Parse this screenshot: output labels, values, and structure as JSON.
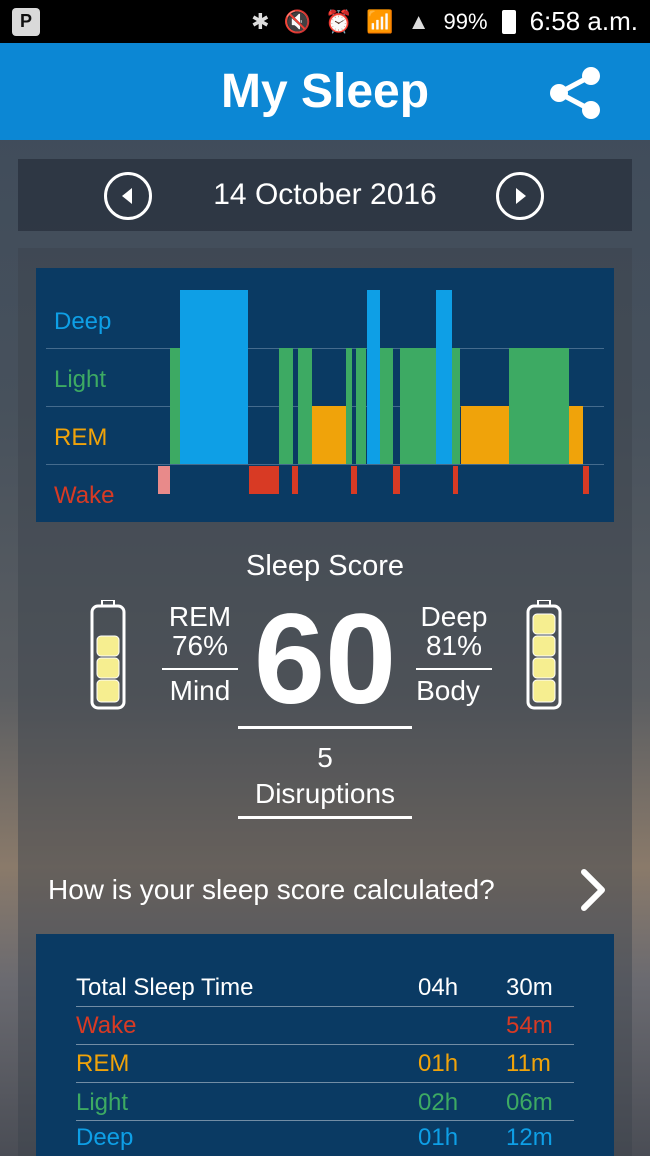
{
  "status_bar": {
    "left_icon": "P",
    "battery_pct": "99%",
    "time": "6:58 a.m."
  },
  "app": {
    "title": "My Sleep"
  },
  "date_nav": {
    "date": "14 October 2016"
  },
  "hypnogram": {
    "labels": [
      "Deep",
      "Light",
      "REM",
      "Wake"
    ],
    "colors": {
      "deep": "#0e9fe6",
      "light": "#3daa63",
      "rem": "#f0a30a",
      "wake": "#d83a24",
      "wake_light": "#e88a8a"
    }
  },
  "score": {
    "title": "Sleep Score",
    "value": "60",
    "rem_label": "REM",
    "rem_pct": "76%",
    "mind_label": "Mind",
    "deep_label": "Deep",
    "deep_pct": "81%",
    "body_label": "Body",
    "disruptions_count": "5",
    "disruptions_label": "Disruptions"
  },
  "calc_link": {
    "text": "How is your sleep score calculated?"
  },
  "summary": {
    "rows": [
      {
        "label": "Total Sleep Time",
        "hours": "04h",
        "minutes": "30m",
        "color": "#ffffff"
      },
      {
        "label": "Wake",
        "hours": "",
        "minutes": "54m",
        "color": "#d83a24"
      },
      {
        "label": "REM",
        "hours": "01h",
        "minutes": "11m",
        "color": "#f0a30a"
      },
      {
        "label": "Light",
        "hours": "02h",
        "minutes": "06m",
        "color": "#3daa63"
      },
      {
        "label": "Deep",
        "hours": "01h",
        "minutes": "12m",
        "color": "#0e9fe6"
      }
    ]
  }
}
